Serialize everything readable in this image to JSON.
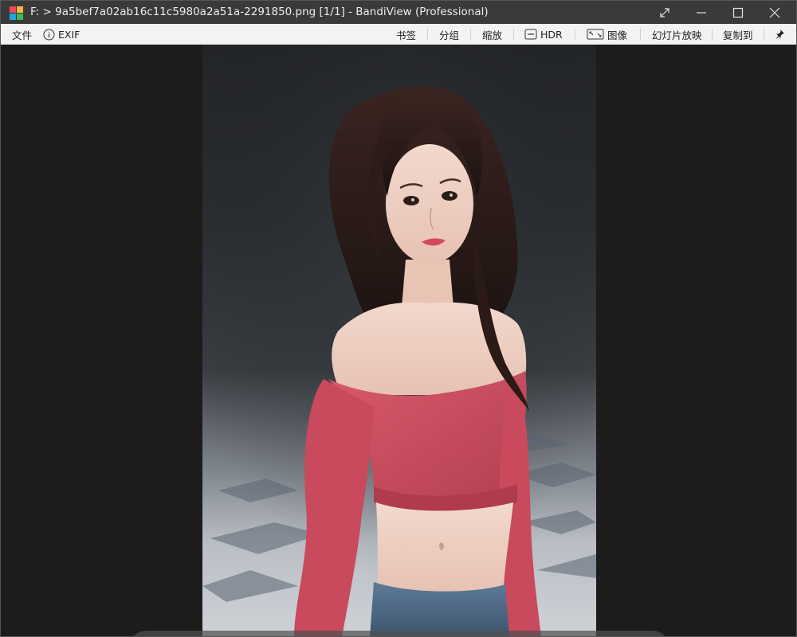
{
  "window": {
    "title": "F: > 9a5bef7a02ab16c11c5980a2a51a-2291850.png [1/1] - BandiView (Professional)",
    "controls": [
      "fullscreen-icon",
      "minimize-icon",
      "maximize-icon",
      "close-icon"
    ]
  },
  "menu": {
    "file": "文件",
    "exif": "EXIF",
    "bookmark": "书签",
    "group": "分组",
    "zoom": "缩放",
    "hdr": "HDR",
    "image": "图像",
    "slideshow": "幻灯片放映",
    "copy_to": "复制到"
  },
  "toolbar": {
    "buttons": [
      "open-folder-icon",
      "list-icon",
      "zoom-out-icon",
      "zoom-fit-icon",
      "zoom-in-icon",
      "rotate-icon",
      "previous-icon",
      "next-icon",
      "pin-icon"
    ]
  },
  "colors": {
    "titlebar": "#3a3a3a",
    "menubar": "#f3f3f3",
    "viewer_bg": "#1c1c1c",
    "sweater": "#c8485a"
  }
}
